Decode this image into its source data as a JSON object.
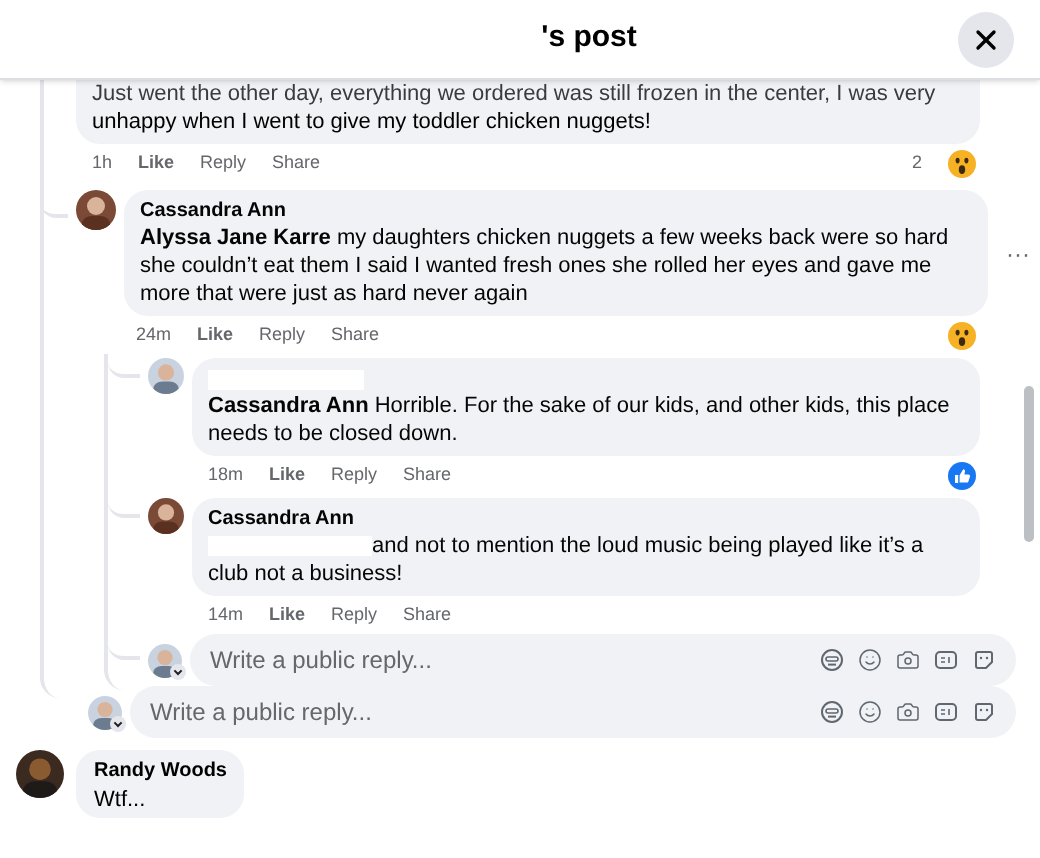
{
  "header": {
    "title": "'s post"
  },
  "top_comment": {
    "cut_line": "Just went the other day, everything we ordered was still frozen in the center, I was very",
    "text": "unhappy when I went to give my toddler chicken nuggets!",
    "time": "1h",
    "actions": [
      "Like",
      "Reply",
      "Share"
    ],
    "reaction_count": "2",
    "reaction": {
      "kind": "wow"
    }
  },
  "replies": [
    {
      "author": "Cassandra Ann",
      "text": "**Alyssa Jane Karre** my daughters chicken nuggets a few weeks back were so hard she couldn’t eat them I said I wanted fresh ones she rolled her eyes and gave me more that were just as hard never again",
      "time": "24m",
      "actions": [
        "Like",
        "Reply",
        "Share"
      ],
      "reaction": {
        "kind": "wow"
      },
      "more": "···",
      "children": [
        {
          "redacted_author": true,
          "text": "**Cassandra Ann** Horrible. For the sake of our kids, and other kids, this place needs to be closed down.",
          "time": "18m",
          "actions": [
            "Like",
            "Reply",
            "Share"
          ],
          "reaction": {
            "kind": "like"
          }
        },
        {
          "author": "Cassandra Ann",
          "redacted_prefix": true,
          "text": "and not to mention the loud music being played like it’s a club not a business!",
          "time": "14m",
          "actions": [
            "Like",
            "Reply",
            "Share"
          ]
        }
      ],
      "reply_box": {
        "placeholder": "Write a public reply..."
      }
    }
  ],
  "reply_box": {
    "placeholder": "Write a public reply..."
  },
  "last_comment": {
    "author": "Randy Woods",
    "text": "Wtf..."
  }
}
